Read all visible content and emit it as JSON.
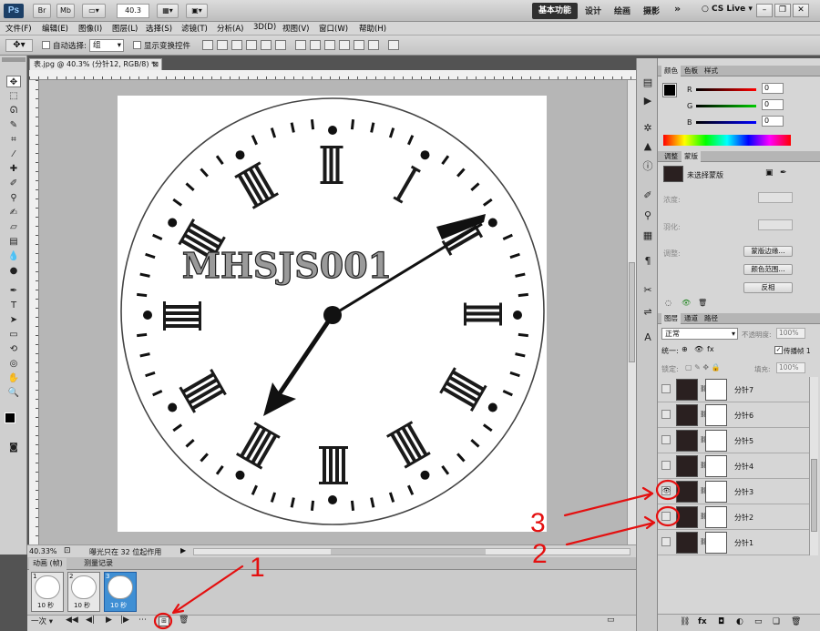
{
  "title_bar": {
    "app_logo": "Ps",
    "br_label": "Br",
    "mb_label": "Mb",
    "zoom": "40.3",
    "workspaces": [
      "基本功能",
      "设计",
      "绘画",
      "摄影"
    ],
    "more": "»",
    "cs_live": "CS Live"
  },
  "menu": [
    "文件(F)",
    "编辑(E)",
    "图像(I)",
    "图层(L)",
    "选择(S)",
    "滤镜(T)",
    "分析(A)",
    "3D(D)",
    "视图(V)",
    "窗口(W)",
    "帮助(H)"
  ],
  "options_bar": {
    "auto_select_label": "自动选择:",
    "auto_select_value": "组",
    "show_transform_label": "显示变换控件"
  },
  "document": {
    "tab_title": "表.jpg @ 40.3% (分针12, RGB/8) *",
    "clock_text": "MHSJS001"
  },
  "status": {
    "zoom": "40.33%",
    "message": "曝光只在 32 位起作用"
  },
  "animation": {
    "tabs": [
      "动画 (帧)",
      "测量记录"
    ],
    "frames": [
      {
        "num": "1",
        "duration": "10 秒"
      },
      {
        "num": "2",
        "duration": "10 秒"
      },
      {
        "num": "3",
        "duration": "10 秒"
      }
    ],
    "loop": "一次"
  },
  "color_panel": {
    "tabs": [
      "颜色",
      "色板",
      "样式"
    ],
    "channels": [
      {
        "label": "R",
        "value": "0",
        "color": "#e01010"
      },
      {
        "label": "G",
        "value": "0",
        "color": "#10a010"
      },
      {
        "label": "B",
        "value": "0",
        "color": "#1030d0"
      }
    ]
  },
  "masks_panel": {
    "tabs": [
      "调整",
      "蒙版"
    ],
    "no_mask": "未选择蒙版",
    "density": "浓度:",
    "feather": "羽化:",
    "refine": "调整:",
    "btn_mask_edge": "蒙版边缘...",
    "btn_color_range": "颜色范围...",
    "btn_invert": "反相"
  },
  "layers_panel": {
    "tabs": [
      "图层",
      "通道",
      "路径"
    ],
    "blend_mode": "正常",
    "opacity_label": "不透明度:",
    "opacity": "100%",
    "unify_label": "统一:",
    "propagate_label": "传播帧 1",
    "lock_label": "锁定:",
    "fill_label": "填充:",
    "fill": "100%",
    "layers": [
      {
        "name": "分针7",
        "visible": false
      },
      {
        "name": "分针6",
        "visible": false
      },
      {
        "name": "分针5",
        "visible": false
      },
      {
        "name": "分针4",
        "visible": false
      },
      {
        "name": "分针3",
        "visible": true
      },
      {
        "name": "分针2",
        "visible": false
      },
      {
        "name": "分针1",
        "visible": false
      }
    ]
  },
  "annotations": [
    "1",
    "2",
    "3"
  ],
  "colors": {
    "annotation_red": "#e41010",
    "selected_frame": "#3f8fd4",
    "active_workspace": "#2f2f2f"
  }
}
